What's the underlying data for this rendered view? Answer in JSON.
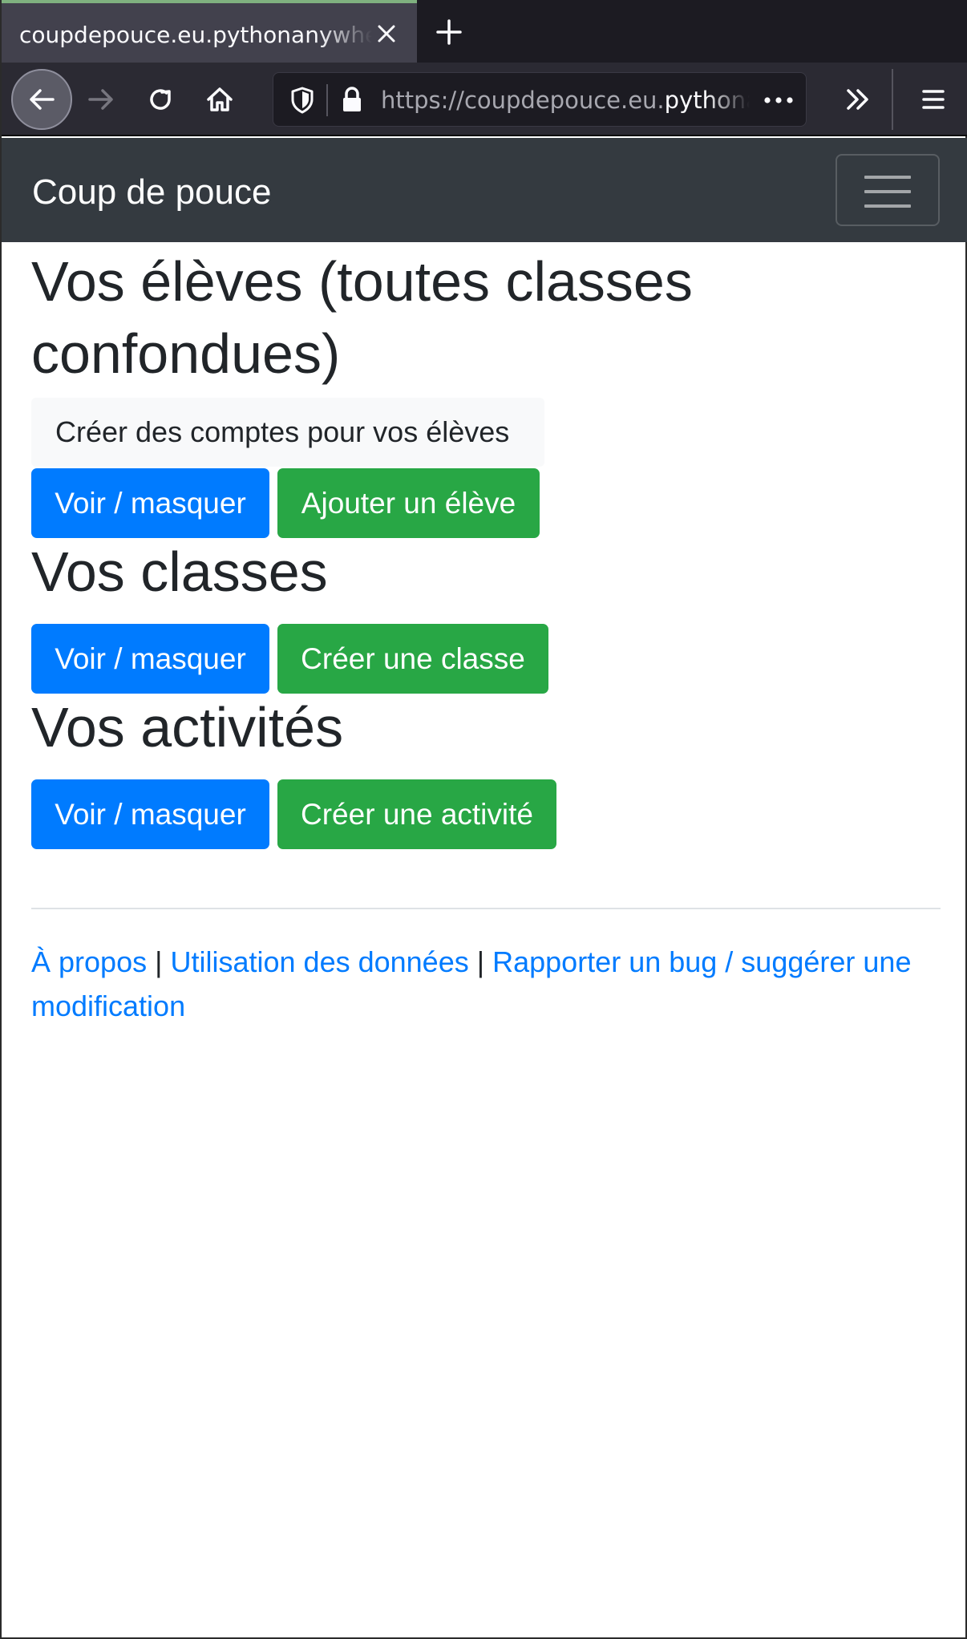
{
  "browser": {
    "tab_title": "coupdepouce.eu.pythonanywhere.com",
    "url_prefix": "https://coupdepouce.eu.",
    "url_host": "pythonanywhere.com/",
    "icons": {
      "tab_close": "close-icon",
      "new_tab": "plus-icon",
      "back": "arrow-left-icon",
      "forward": "arrow-right-icon",
      "reload": "reload-icon",
      "home": "home-icon",
      "shield": "shield-icon",
      "lock": "lock-icon",
      "page_actions": "more-horizontal-icon",
      "overflow": "double-chevron-right-icon",
      "menu": "hamburger-icon"
    }
  },
  "site": {
    "brand": "Coup de pouce"
  },
  "students": {
    "heading": "Vos élèves (toutes classes confondues)",
    "accounts_label": "Créer des comptes pour vos élèves",
    "toggle_label": "Voir / masquer",
    "add_label": "Ajouter un élève"
  },
  "classes": {
    "heading": "Vos classes",
    "toggle_label": "Voir / masquer",
    "create_label": "Créer une classe"
  },
  "activities": {
    "heading": "Vos activités",
    "toggle_label": "Voir / masquer",
    "create_label": "Créer une activité"
  },
  "footer": {
    "about": "À propos",
    "data_usage": "Utilisation des données",
    "report": "Rapporter un bug / suggérer une modification",
    "separator": "|"
  },
  "colors": {
    "primary": "#007bff",
    "success": "#28a745",
    "navbar_dark": "#343a40"
  }
}
